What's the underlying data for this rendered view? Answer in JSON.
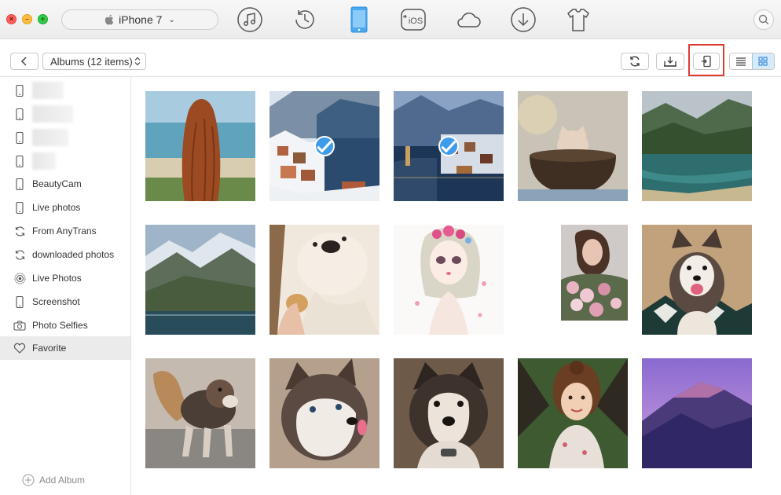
{
  "titlebar": {
    "device_name": "iPhone 7",
    "nav_icons": [
      "music-icon",
      "history-icon",
      "phone-icon",
      "to-ios-icon",
      "cloud-icon",
      "download-icon",
      "shirt-icon"
    ],
    "to_ios_label": "iOS"
  },
  "toolbar": {
    "album_select": "Albums (12 items)"
  },
  "sidebar": {
    "items": [
      {
        "label": "BeautyCam",
        "icon": "phone-icon"
      },
      {
        "label": "Live photos",
        "icon": "phone-icon"
      },
      {
        "label": "From AnyTrans",
        "icon": "sync-icon"
      },
      {
        "label": "downloaded photos",
        "icon": "sync-icon"
      },
      {
        "label": "Live Photos",
        "icon": "live-photo-icon"
      },
      {
        "label": "Screenshot",
        "icon": "phone-icon"
      },
      {
        "label": "Photo Selfies",
        "icon": "camera-icon"
      },
      {
        "label": "Favorite",
        "icon": "heart-icon"
      }
    ],
    "add_album": "Add Album"
  },
  "photos": [
    {
      "subject": "woman-at-beach",
      "selected": false
    },
    {
      "subject": "snowy-lake-town",
      "selected": true
    },
    {
      "subject": "lake-town-dusk",
      "selected": true
    },
    {
      "subject": "kitten-in-bowl",
      "selected": false
    },
    {
      "subject": "mountain-lake",
      "selected": false
    },
    {
      "subject": "mountain-valley-lake",
      "selected": false
    },
    {
      "subject": "white-dog-eating",
      "selected": false
    },
    {
      "subject": "flower-girl-illustration",
      "selected": false
    },
    {
      "subject": "woman-with-flowers",
      "selected": false
    },
    {
      "subject": "husky-puppy-smiling",
      "selected": false
    },
    {
      "subject": "husky-puppy-walking",
      "selected": false
    },
    {
      "subject": "husky-puppy-tongue",
      "selected": false
    },
    {
      "subject": "puppy-face",
      "selected": false
    },
    {
      "subject": "girl-portrait",
      "selected": false
    },
    {
      "subject": "purple-mountain",
      "selected": false
    }
  ],
  "colors": {
    "accent": "#3d9bea",
    "highlight": "#e03a2f",
    "sidebar_active": "#ebebeb"
  }
}
